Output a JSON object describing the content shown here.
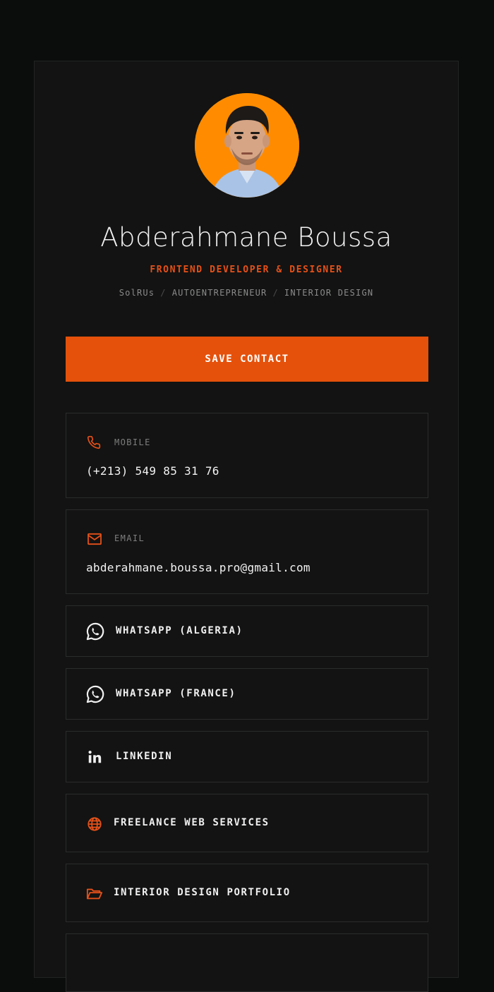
{
  "profile": {
    "name": "Abderahmane Boussa",
    "role": "FRONTEND DEVELOPER & DESIGNER",
    "meta": [
      "SolRUs",
      "AUTOENTREPRENEUR",
      "INTERIOR DESIGN"
    ],
    "meta_separator": "/"
  },
  "actions": {
    "save_contact": "SAVE CONTACT"
  },
  "contacts": {
    "mobile": {
      "label": "MOBILE",
      "value": "(+213) 549 85 31 76",
      "icon": "phone-icon"
    },
    "email": {
      "label": "EMAIL",
      "value": "abderahmane.boussa.pro@gmail.com",
      "icon": "mail-icon"
    }
  },
  "links": [
    {
      "label": "WHATSAPP (ALGERIA)",
      "icon": "whatsapp-icon"
    },
    {
      "label": "WHATSAPP (FRANCE)",
      "icon": "whatsapp-icon"
    },
    {
      "label": "LINKEDIN",
      "icon": "linkedin-icon"
    },
    {
      "label": "FREELANCE WEB SERVICES",
      "icon": "globe-icon"
    },
    {
      "label": "INTERIOR DESIGN PORTFOLIO",
      "icon": "folder-open-icon"
    }
  ],
  "colors": {
    "background": "#0b0c0c",
    "card": "#121312",
    "accent": "#e5510b",
    "avatar_bg": "#ff8c00"
  }
}
